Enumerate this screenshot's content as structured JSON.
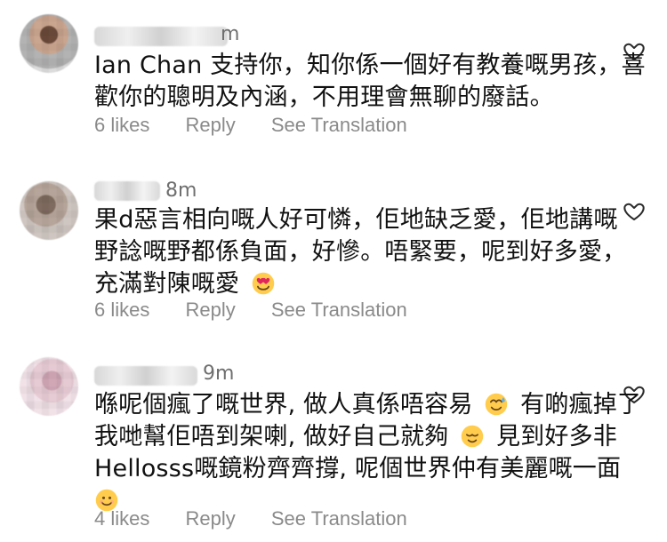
{
  "comments": [
    {
      "time": "m",
      "text_lines": [
        "Ian Chan 支持你，知你係一個好有教養嘅男孩，喜",
        "歡你的聰明及內涵，不用理會無聊的廢話。"
      ],
      "likes": "6 likes",
      "reply": "Reply",
      "translation": "See Translation"
    },
    {
      "time": "8m",
      "text_lines": [
        "果d惡言相向嘅人好可憐，佢地缺乏愛，佢地講嘅",
        "野諗嘅野都係負面，好慘。唔緊要，呢到好多愛，",
        "充滿對陳嘅愛"
      ],
      "likes": "6 likes",
      "reply": "Reply",
      "translation": "See Translation",
      "emoji": "heart-eyes"
    },
    {
      "time": "9m",
      "text_lines": [
        "喺呢個瘋了嘅世界, 做人真係唔容易",
        "有啲瘋掉了",
        "我哋幫佢唔到架喇, 做好自己就夠",
        "見到好多非",
        "Hellosss嘅鏡粉齊齊撐, 呢個世界仲有美麗嘅一面"
      ],
      "likes": "4 likes",
      "reply": "Reply",
      "translation": "See Translation",
      "emojis": [
        "sweat-smile",
        "relieved",
        "smiling-face"
      ]
    }
  ],
  "colors": {
    "text": "#111111",
    "meta": "#8a8a8a",
    "time": "#6f6f6f",
    "heart_outline": "#2a2a2a",
    "emoji_yellow": "#ffcc4d",
    "emoji_red": "#e0245e"
  },
  "icons": {
    "heart": "heart-outline-icon"
  }
}
